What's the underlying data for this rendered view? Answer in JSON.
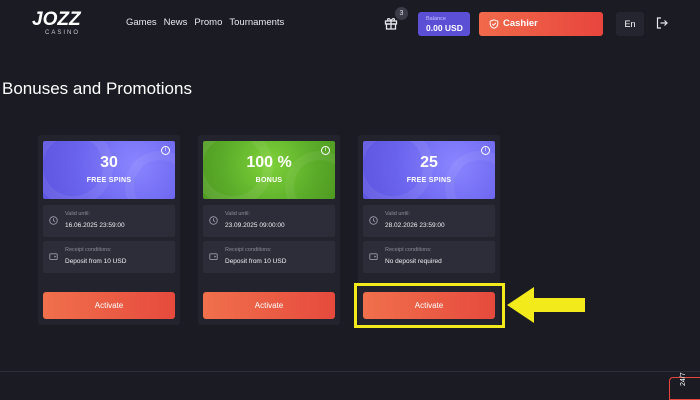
{
  "header": {
    "logo_main": "JOZZ",
    "logo_sub": "CASINO",
    "nav": [
      "Games",
      "News",
      "Promo",
      "Tournaments"
    ],
    "gift_count": "3",
    "balance_label": "Balance",
    "balance_value": "0.00 USD",
    "cashier_label": "Cashier",
    "lang": "En",
    "icons": {
      "gift": "gift-icon",
      "cashier": "shield-check-icon",
      "logout": "logout-icon"
    }
  },
  "page": {
    "title": "Bonuses and Promotions"
  },
  "bonuses": [
    {
      "value": "30",
      "subtitle": "FREE SPINS",
      "color": "#6a63ee",
      "valid_label": "Valid until:",
      "valid_value": "16.06.2025 23:59:00",
      "cond_label": "Receipt conditions:",
      "cond_value": "Deposit from 10 USD",
      "button": "Activate"
    },
    {
      "value": "100 %",
      "subtitle": "BONUS",
      "color": "#5cad2a",
      "valid_label": "Valid until:",
      "valid_value": "23.09.2025 09:00:00",
      "cond_label": "Receipt conditions:",
      "cond_value": "Deposit from 10 USD",
      "button": "Activate"
    },
    {
      "value": "25",
      "subtitle": "FREE SPINS",
      "color": "#6a63ee",
      "valid_label": "Valid until:",
      "valid_value": "28.02.2026 23:59:00",
      "cond_label": "Receipt conditions:",
      "cond_value": "No deposit required",
      "button": "Activate"
    }
  ],
  "annotation": {
    "highlight_color": "#f2ea1a"
  },
  "side_tab": {
    "label": "24/7"
  }
}
